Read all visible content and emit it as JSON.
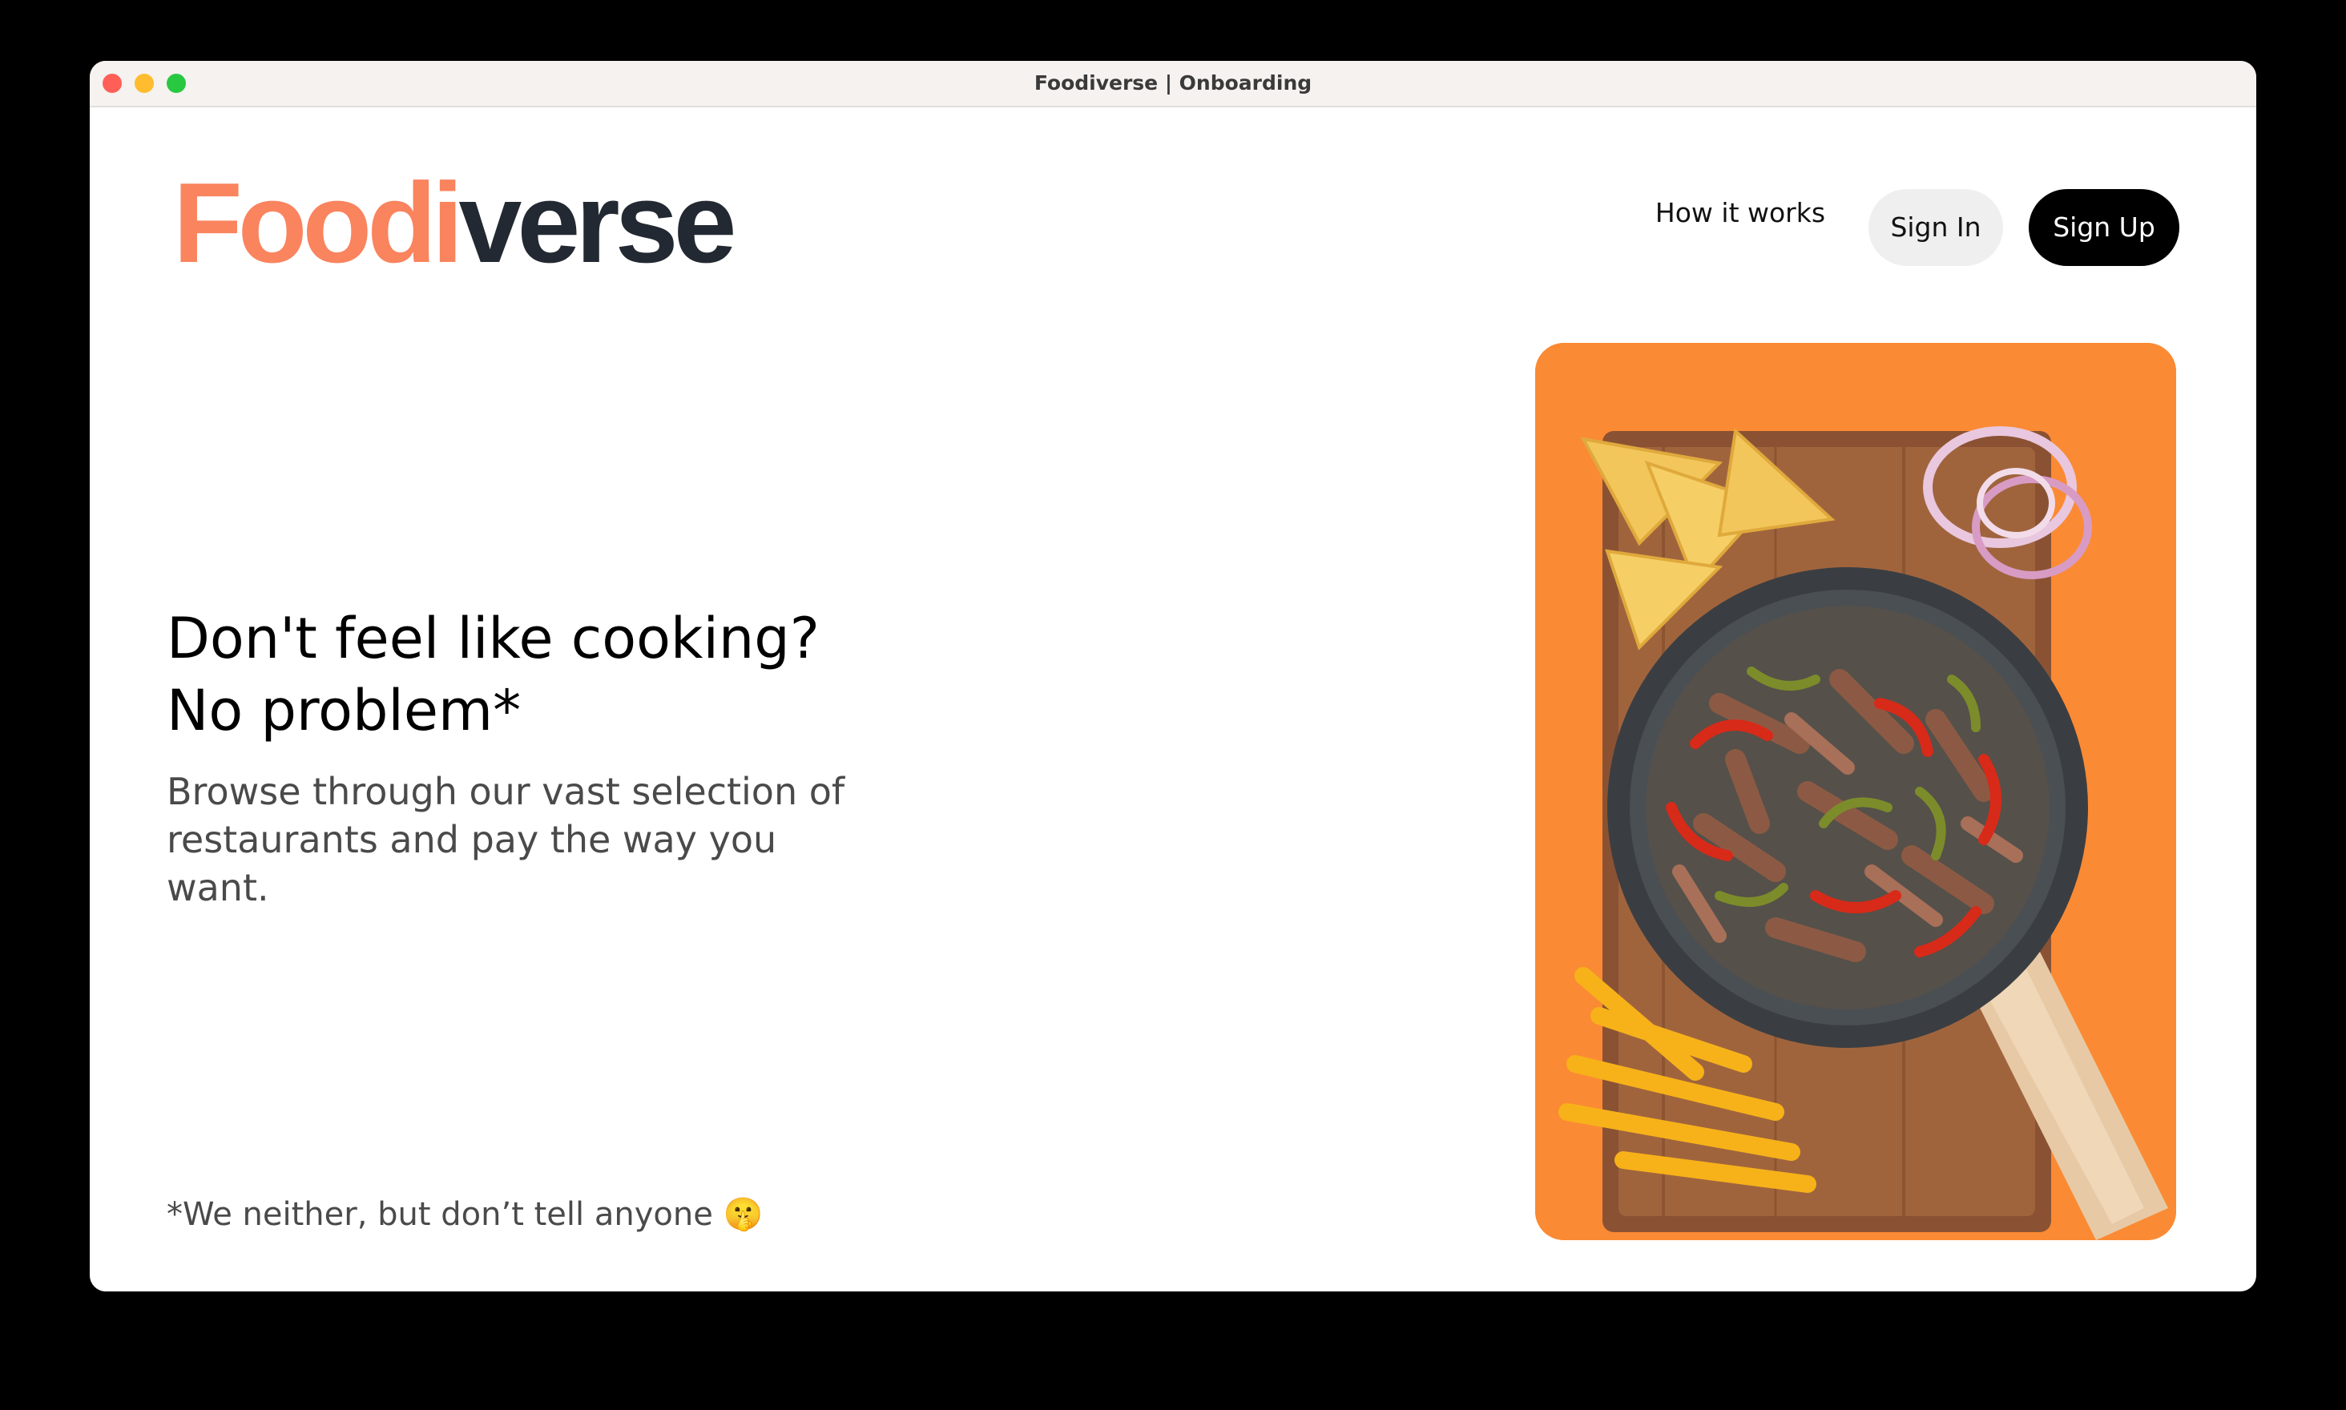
{
  "window": {
    "title": "Foodiverse | Onboarding"
  },
  "header": {
    "logo_part1": "Foodi",
    "logo_part2": "verse",
    "nav_how_it_works": "How it works",
    "sign_in_label": "Sign In",
    "sign_up_label": "Sign Up"
  },
  "hero": {
    "headline_line1": "Don't feel like cooking?",
    "headline_line2": "No problem*",
    "subtext": "Browse through our vast selection of restaurants and pay the way you want.",
    "footnote": "*We neither, but don’t tell anyone",
    "footnote_emoji": "🤫",
    "image_description_icon": "food-photo-fajitas-pan"
  },
  "colors": {
    "logo_accent": "#f9845e",
    "logo_dark": "#232932",
    "hero_background": "#fb8a34",
    "sign_up_bg": "#000000",
    "sign_in_bg": "#efefef"
  }
}
